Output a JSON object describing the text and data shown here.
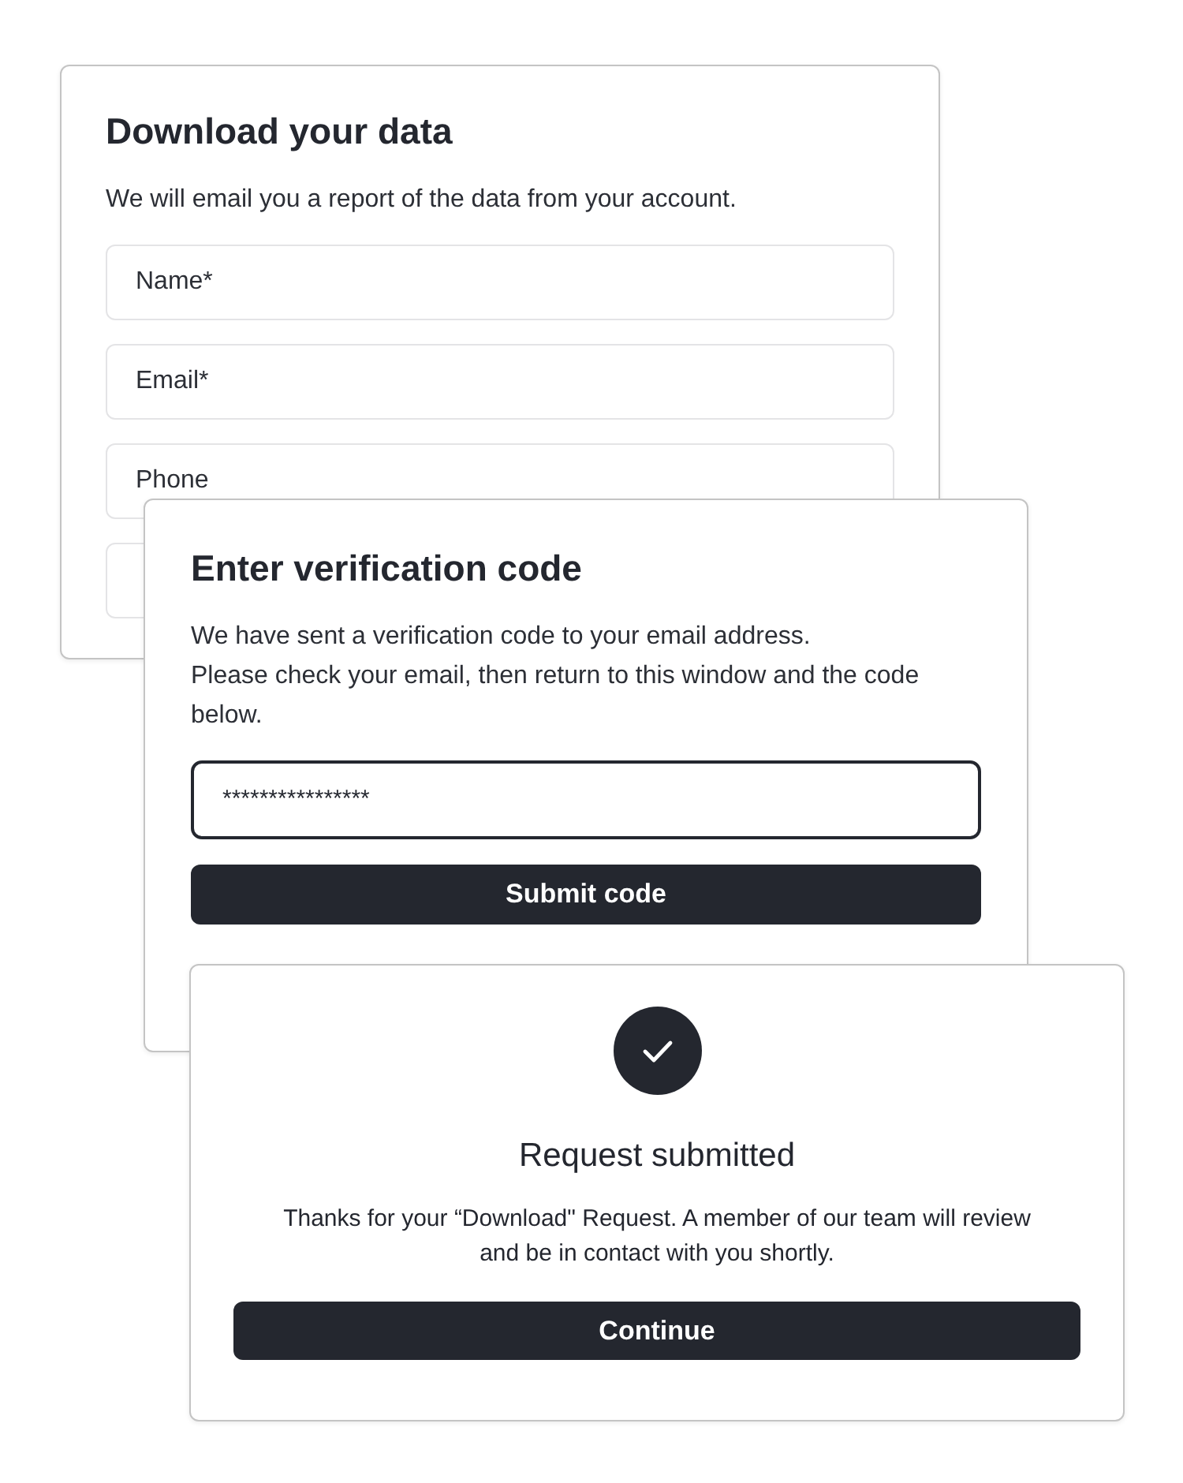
{
  "download_card": {
    "title": "Download your data",
    "description": "We will email you a report of the data from your account.",
    "fields": [
      {
        "kind": "input",
        "placeholder": "Name*"
      },
      {
        "kind": "input",
        "placeholder": "Email*"
      },
      {
        "kind": "input",
        "placeholder": "Phone"
      },
      {
        "kind": "input"
      }
    ]
  },
  "verification_card": {
    "title": "Enter verification code",
    "description": "We have sent a verification code to your email address.\nPlease check your email, then return to this window and the code below.",
    "code_field": {
      "value": "****************",
      "focused": true
    },
    "button": "Submit code"
  },
  "success_card": {
    "title": "Request submitted",
    "message": "Thanks for your “Download\" Request. A member of our team will review and be in contact with you shortly.",
    "button": "Continue"
  }
}
